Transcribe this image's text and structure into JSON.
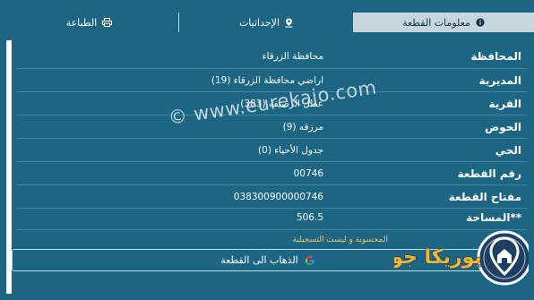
{
  "tabs": {
    "parcel_info": "معلومات القطعة",
    "coordinates": "الإحداثيات",
    "print": "الطباعة"
  },
  "rows": [
    {
      "label": "المحافظة",
      "value": "محافظة الزرقاء"
    },
    {
      "label": "المديرية",
      "value": "اراضي محافظة الزرقاء (19)"
    },
    {
      "label": "القرية",
      "value": "عطل الرصيفه (383)"
    },
    {
      "label": "الحوض",
      "value": "مرزقه (9)"
    },
    {
      "label": "الحي",
      "value": "جدول الأحياء (0)"
    },
    {
      "label": "رقم القطعة",
      "value": "00746"
    },
    {
      "label": "مفتاح القطعة",
      "value": "038300900000746"
    },
    {
      "label": "**المساحة",
      "value": "506.5"
    }
  ],
  "note": "المحسوبة و ليست التسجيلية",
  "goto_button": "الذهاب الى القطعة",
  "watermark": "© www.eurekajo.com",
  "logo_text": "يوريكا جو",
  "colors": {
    "background": "#1c6684",
    "active_tab": "#c7d6de",
    "accent": "#f2c25c",
    "logo_dark": "#1d3f63"
  }
}
